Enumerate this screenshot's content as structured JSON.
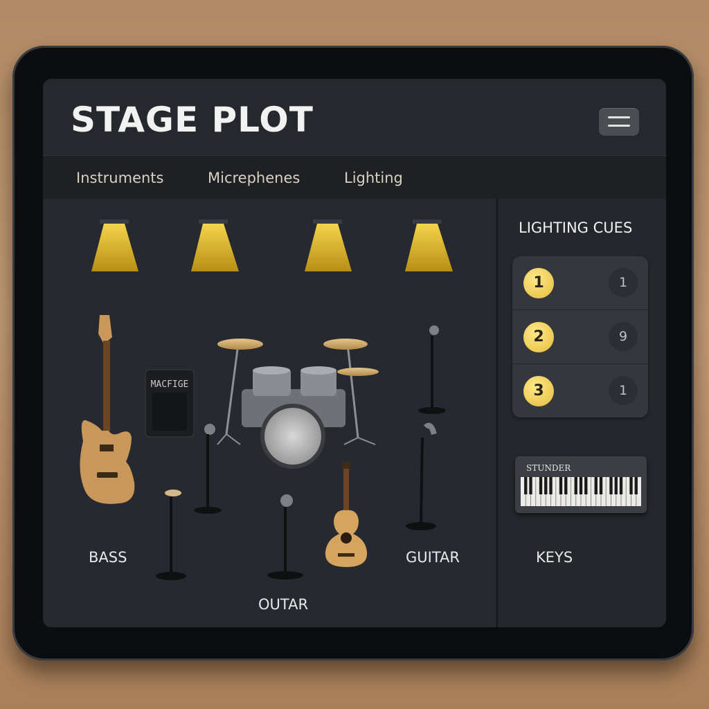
{
  "app": {
    "title": "STAGE PLOT"
  },
  "tabs": [
    {
      "label": "Instruments"
    },
    {
      "label": "Micrephenes"
    },
    {
      "label": "Lighting"
    }
  ],
  "stage": {
    "amp_label": "MACFIGE",
    "labels": {
      "bass": "BASS",
      "outar": "OUTAR",
      "guitar": "GUITAR"
    }
  },
  "sidebar": {
    "cues_title": "LIGHTING CUES",
    "cues": [
      {
        "number": "1",
        "value": "1"
      },
      {
        "number": "2",
        "value": "9"
      },
      {
        "number": "3",
        "value": "1"
      }
    ],
    "keyboard_brand": "STUNDER",
    "keys_label": "KEYS"
  },
  "colors": {
    "accent_gold": "#e3bb3a",
    "light_beam": "#d9b22c",
    "wood": "#c9975a",
    "screen_bg": "#23262b"
  }
}
